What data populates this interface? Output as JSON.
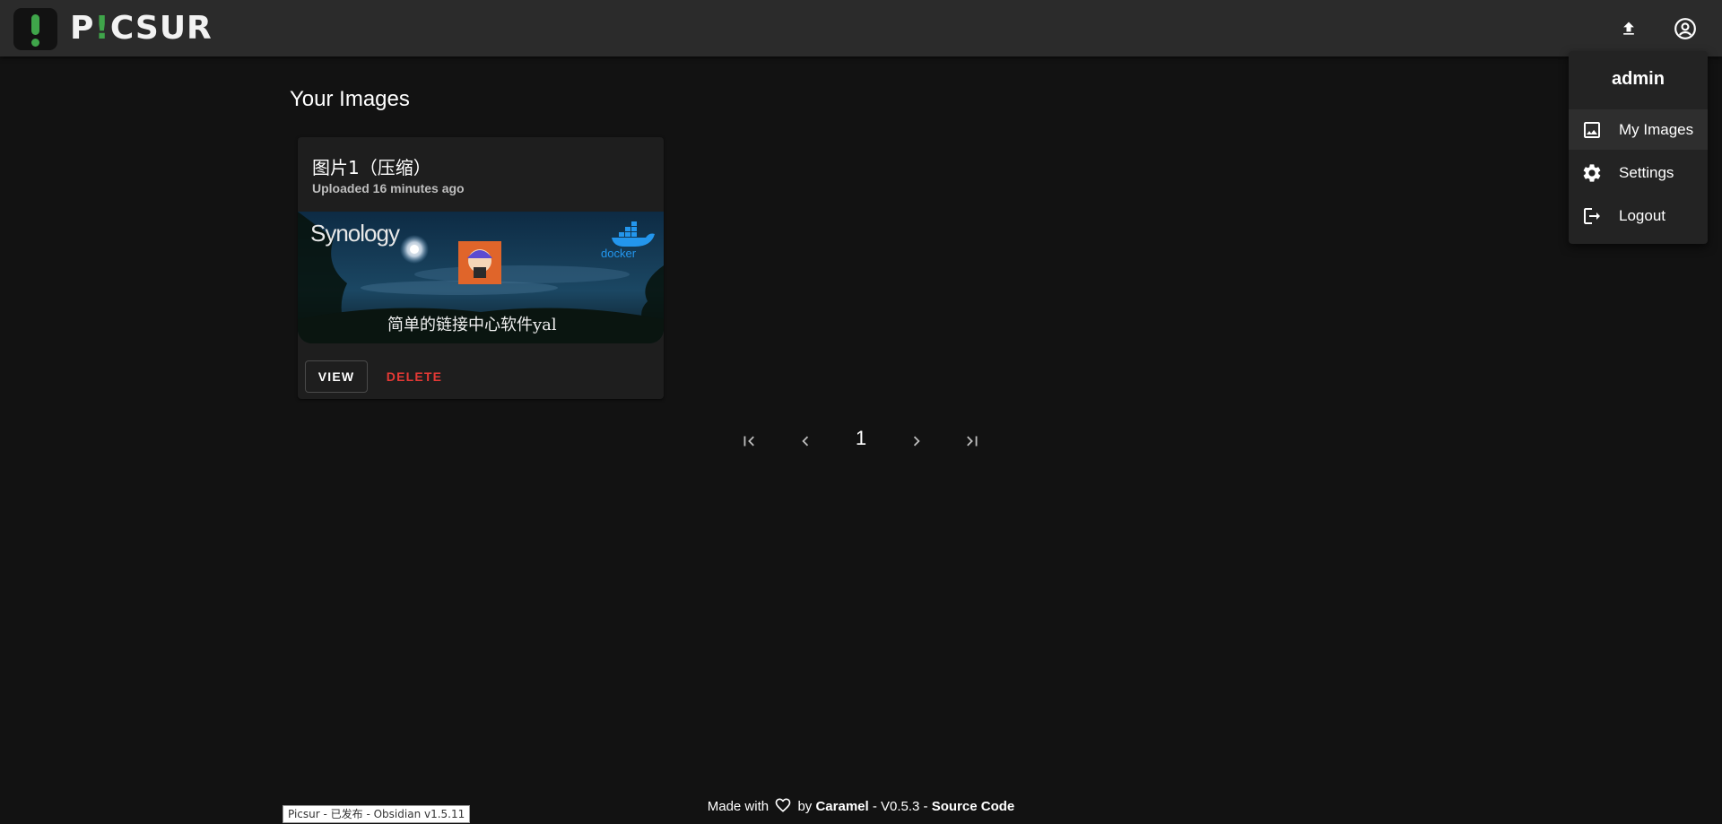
{
  "app": {
    "logo_prefix": "P",
    "logo_mark": "!",
    "logo_suffix": "CSUR"
  },
  "header": {
    "upload_icon": "upload-icon",
    "account_icon": "account-circle-icon"
  },
  "main": {
    "title": "Your Images"
  },
  "images": [
    {
      "title": "图片1（压缩）",
      "uploaded": "Uploaded 16 minutes ago",
      "thumbnail": {
        "brand": "Synology",
        "tagline": "简单的链接中心软件yal",
        "badge": "docker"
      },
      "view_label": "VIEW",
      "delete_label": "DELETE"
    }
  ],
  "pagination": {
    "current_page": "1",
    "icons": [
      "first-page-icon",
      "chevron-left-icon",
      "chevron-right-icon",
      "last-page-icon"
    ]
  },
  "user_menu": {
    "username": "admin",
    "items": [
      {
        "label": "My Images",
        "icon": "image-icon",
        "active": true
      },
      {
        "label": "Settings",
        "icon": "gear-icon",
        "active": false
      },
      {
        "label": "Logout",
        "icon": "logout-icon",
        "active": false
      }
    ]
  },
  "footer": {
    "made_with": "Made with",
    "by": "by",
    "author": "Caramel",
    "version": "- V0.5.3 -",
    "source": "Source Code"
  },
  "tooltip": {
    "text": "Picsur - 已发布 - Obsidian v1.5.11"
  },
  "colors": {
    "accent_green": "#3fa54a",
    "delete_red": "#e53935",
    "topbar": "#2b2b2b",
    "background": "#121212"
  }
}
